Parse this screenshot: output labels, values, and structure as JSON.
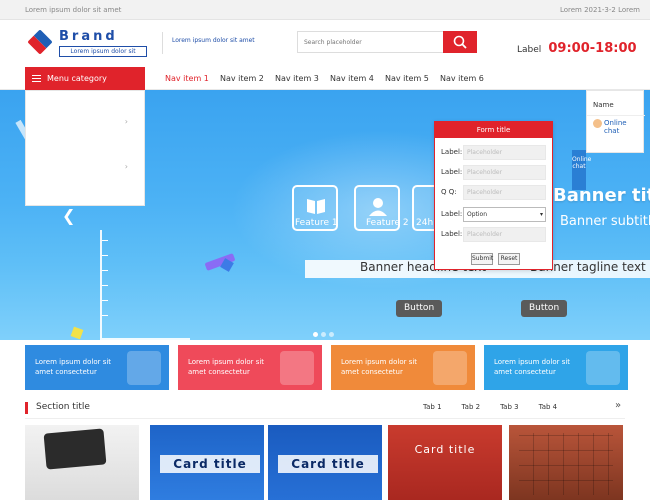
{
  "topbar": {
    "welcome": "Lorem ipsum dolor sit amet",
    "date": "Lorem 2021-3-2 Lorem"
  },
  "header": {
    "logo_title": "Brand",
    "logo_subtitle": "Lorem ipsum dolor sit",
    "slogan": "Lorem ipsum dolor sit amet",
    "search_placeholder": "Search placeholder",
    "hotline_label": "Label",
    "hotline_time": "09:00-18:00"
  },
  "nav": {
    "category_label": "Menu category",
    "items": [
      {
        "label": "Nav item 1",
        "active": true
      },
      {
        "label": "Nav item 2",
        "active": false
      },
      {
        "label": "Nav item 3",
        "active": false
      },
      {
        "label": "Nav item 4",
        "active": false
      },
      {
        "label": "Nav item 5",
        "active": false
      },
      {
        "label": "Nav item 6",
        "active": false
      }
    ]
  },
  "banner": {
    "features": [
      {
        "label": "Feature 1",
        "icon": "book-icon"
      },
      {
        "label": "Feature 2",
        "icon": "graduate-icon"
      },
      {
        "label": "24h",
        "icon": "clock-icon"
      }
    ],
    "strip_left": "Banner headline text",
    "strip_right": "Banner tagline text",
    "btn_view_school": "Button",
    "btn_view_major": "Button",
    "title": "Banner title",
    "subtitle": "Banner subtitle",
    "slide_count": 3,
    "active_slide": 0
  },
  "quick_form": {
    "title": "Form title",
    "fields": [
      {
        "label": "Label:",
        "placeholder": "Placeholder"
      },
      {
        "label": "Label:",
        "placeholder": "Placeholder"
      },
      {
        "label": "Q Q:",
        "placeholder": "Placeholder"
      }
    ],
    "education_label": "Label:",
    "education_value": "Option",
    "major_label": "Label:",
    "major_placeholder": "Placeholder",
    "submit": "Submit",
    "reset": "Reset"
  },
  "consult": {
    "teacher": "Name",
    "online": "Online chat",
    "side_tab": "Online chat"
  },
  "promos": [
    {
      "text": "Lorem ipsum dolor sit amet consectetur",
      "color": "#2f8be0"
    },
    {
      "text": "Lorem ipsum dolor sit amet consectetur",
      "color": "#ef4a5a"
    },
    {
      "text": "Lorem ipsum dolor sit amet consectetur",
      "color": "#f08a3a"
    },
    {
      "text": "Lorem ipsum dolor sit amet consectetur",
      "color": "#2fa4e8"
    }
  ],
  "section": {
    "title": "Section title",
    "tabs": [
      "Tab 1",
      "Tab 2",
      "Tab 3",
      "Tab 4"
    ],
    "more": "»"
  },
  "thumbnails": [
    {
      "title": ""
    },
    {
      "title": "Card title"
    },
    {
      "title": "Card title"
    },
    {
      "title": "Card title"
    },
    {
      "title": ""
    }
  ],
  "colors": {
    "brand_red": "#e0232b",
    "brand_blue": "#1f4ea8"
  }
}
